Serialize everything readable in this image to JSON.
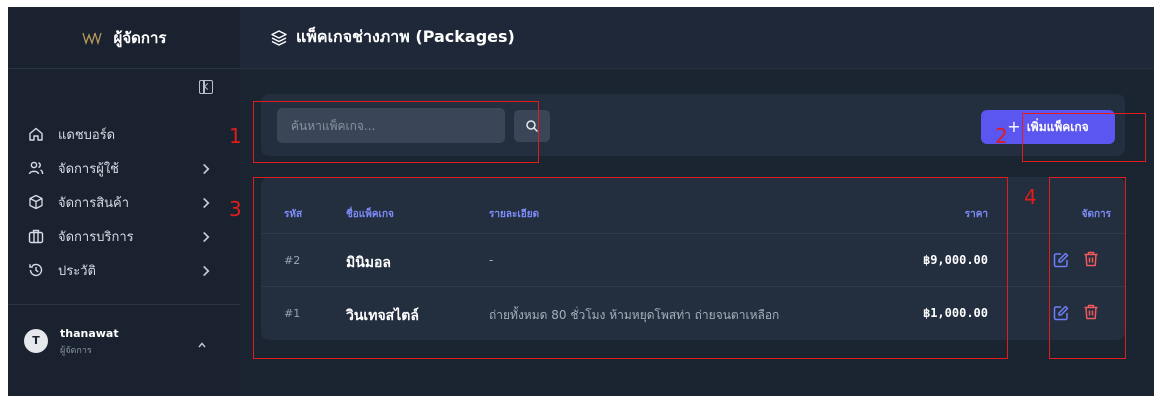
{
  "sidebar": {
    "brand_title": "ผู้จัดการ",
    "collapse_icon": "sidebar-collapse-icon",
    "items": [
      {
        "label": "แดชบอร์ด",
        "icon": "home-icon",
        "has_submenu": false
      },
      {
        "label": "จัดการผู้ใช้",
        "icon": "users-icon",
        "has_submenu": true
      },
      {
        "label": "จัดการสินค้า",
        "icon": "box-icon",
        "has_submenu": true
      },
      {
        "label": "จัดการบริการ",
        "icon": "briefcase-icon",
        "has_submenu": true
      },
      {
        "label": "ประวัติ",
        "icon": "history-icon",
        "has_submenu": true
      }
    ],
    "user": {
      "initial": "T",
      "name": "thanawat",
      "role": "ผู้จัดการ"
    }
  },
  "header": {
    "title": "แพ็คเกจช่างภาพ (Packages)",
    "icon": "layers-icon"
  },
  "toolbar": {
    "search_placeholder": "ค้นหาแพ็คเกจ...",
    "search_icon": "search-icon",
    "add_plus": "+",
    "add_label": "เพิ่มแพ็คเกจ"
  },
  "table": {
    "columns": {
      "id": "รหัส",
      "name": "ชื่อแพ็คเกจ",
      "desc": "รายละเอียด",
      "price": "ราคา",
      "actions": "จัดการ"
    },
    "rows": [
      {
        "id": "#2",
        "name": "มินิมอล",
        "desc": "-",
        "price": "฿9,000.00"
      },
      {
        "id": "#1",
        "name": "วินเทจสไตล์",
        "desc": "ถ่ายทั้งหมด 80 ชั่วโมง ห้ามหยุดโพสท่า ถ่ายจนตาเหลือก",
        "price": "฿1,000.00"
      }
    ]
  },
  "annotations": [
    "1",
    "2",
    "3",
    "4"
  ],
  "colors": {
    "accent": "#5b56f0",
    "header_text": "#7d8cf8",
    "annotation": "#e01c1c",
    "delete": "#f05a5a",
    "edit": "#6f7ff7"
  }
}
